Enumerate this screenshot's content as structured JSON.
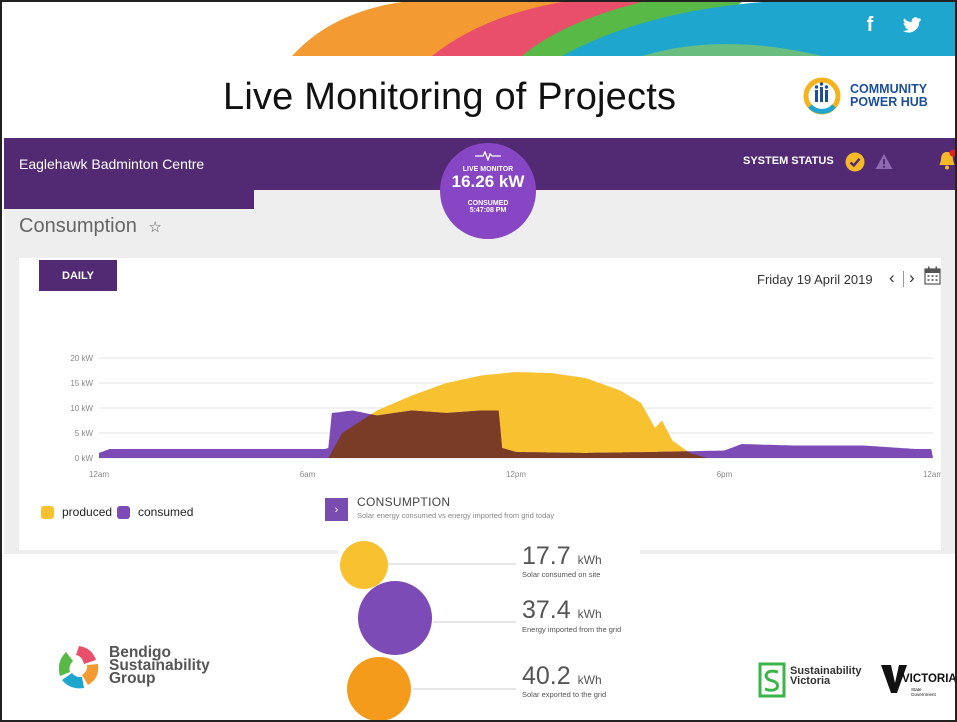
{
  "slide": {
    "title": "Live Monitoring of Projects",
    "social": {
      "facebook": "f",
      "twitter": "twitter-bird"
    }
  },
  "brand": {
    "community_power_hub": [
      "COMMUNITY",
      "POWER HUB"
    ],
    "bendigo": [
      "Bendigo",
      "Sustainability",
      "Group"
    ],
    "sustainability_victoria": [
      "Sustainability",
      "Victoria"
    ],
    "victoria": "VICTORIA",
    "victoria_sub": [
      "State",
      "Government"
    ]
  },
  "app": {
    "site_name": "Eaglehawk Badminton Centre",
    "system_status": "SYSTEM STATUS",
    "live_monitor": {
      "label": "LIVE MONITOR",
      "value": "16.26 kW",
      "consumed_label": "CONSUMED",
      "time": "5:47:08 PM"
    },
    "page_heading": "Consumption",
    "tab": "DAILY",
    "date": "Friday 19 April 2019",
    "legend": [
      "produced",
      "consumed"
    ]
  },
  "consumption": {
    "title": "CONSUMPTION",
    "subtitle": "Solar energy consumed vs energy imported from grid today",
    "stats": [
      {
        "value": "17.7",
        "unit": "kWh",
        "desc": "Solar consumed on site"
      },
      {
        "value": "37.4",
        "unit": "kWh",
        "desc": "Energy imported from the grid"
      },
      {
        "value": "40.2",
        "unit": "kWh",
        "desc": "Solar exported to the grid"
      }
    ]
  },
  "colors": {
    "produced": "#f7c130",
    "consumed": "#7c4bb5",
    "overlap": "#7a3c27",
    "header": "#512a73",
    "monitor": "#8746c4",
    "exported": "#f59b1c"
  },
  "chart_data": {
    "type": "area",
    "xlabel": "",
    "ylabel": "",
    "x_ticks": [
      "12am",
      "6am",
      "12pm",
      "6pm",
      "12am"
    ],
    "y_ticks": [
      "0 kW",
      "5 kW",
      "10 kW",
      "15 kW",
      "20 kW"
    ],
    "ylim": [
      0,
      20
    ],
    "x_unit": "hour of day",
    "legend_position": "bottom-left",
    "grid": true,
    "series": [
      {
        "name": "produced",
        "x": [
          0,
          6.6,
          7.0,
          8.0,
          9.0,
          10.0,
          11.0,
          12.0,
          13.0,
          14.0,
          15.0,
          15.6,
          16.0,
          16.2,
          16.5,
          17.0,
          17.5,
          24
        ],
        "values": [
          0,
          0,
          5.0,
          9.5,
          12.5,
          15.0,
          16.5,
          17.2,
          17.0,
          16.0,
          13.5,
          11.0,
          6.0,
          7.5,
          3.5,
          1.0,
          0,
          0
        ]
      },
      {
        "name": "consumed",
        "x": [
          0,
          0.3,
          6.5,
          6.6,
          6.7,
          7.3,
          8.0,
          9.0,
          10.0,
          11.0,
          11.5,
          11.6,
          12.0,
          14.0,
          16.0,
          18.0,
          18.5,
          20.0,
          22.0,
          23.5,
          24
        ],
        "values": [
          1.0,
          1.8,
          1.8,
          2.0,
          9.0,
          9.5,
          8.5,
          9.5,
          9.0,
          9.5,
          9.5,
          2.0,
          1.2,
          1.0,
          1.2,
          1.5,
          2.8,
          2.5,
          2.5,
          1.8,
          1.8
        ]
      }
    ]
  }
}
